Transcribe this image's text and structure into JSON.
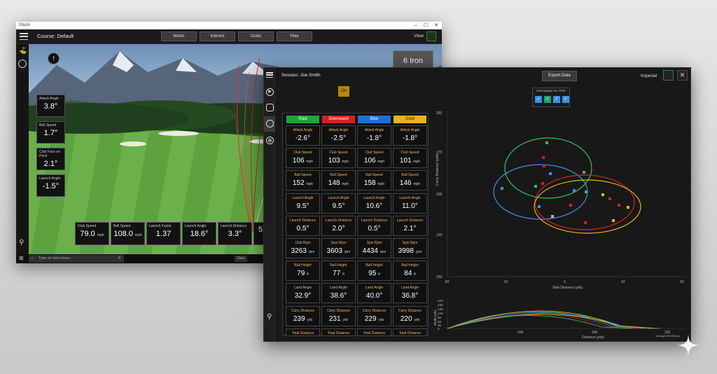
{
  "win1": {
    "title": "Gluon",
    "course_label": "Course: Default",
    "tabs": [
      "Metric",
      "Interest",
      "Clubs",
      "Hole"
    ],
    "view_label": "View",
    "club": "6 Iron",
    "left_stats": [
      {
        "label": "Attack Angle",
        "value": "3.8°"
      },
      {
        "label": "Ball Speed",
        "value": "1.7°"
      },
      {
        "label": "Club Face on Pnch",
        "value": "2.1°"
      },
      {
        "label": "Launch Angle",
        "value": "-1.5°"
      }
    ],
    "bottom_stats": [
      {
        "label": "Club Speed",
        "value": "79.0",
        "unit": "mph"
      },
      {
        "label": "Ball Speed",
        "value": "108.0",
        "unit": "mph"
      },
      {
        "label": "Launch Factor",
        "value": "1.37",
        "unit": ""
      },
      {
        "label": "Launch Angle",
        "value": "18.6°",
        "unit": ""
      },
      {
        "label": "Launch Distance",
        "value": "3.3°",
        "unit": ""
      },
      {
        "label": "",
        "value": "5",
        "unit": ""
      }
    ],
    "taskbar_search": "Type or microtone...",
    "taskbar_item": "Stats"
  },
  "win2": {
    "session": "Session: Joe Smith",
    "export_label": "Export Data",
    "imperial_label": "Imperial",
    "on_label": "On",
    "legend_title": "Dolnoapary loe ODR",
    "legend_colors": [
      "#3b8fe0",
      "#2ec46b",
      "#3b8fe0",
      "#3b8fe0"
    ],
    "columns": [
      {
        "name": "Raid",
        "bg": "#1fa33a",
        "color": "#ffffff"
      },
      {
        "name": "Downward",
        "bg": "#d42020",
        "color": "#ffffff"
      },
      {
        "name": "Blue",
        "bg": "#1f6fd6",
        "color": "#ffffff"
      },
      {
        "name": "Gold",
        "bg": "#e8b21c",
        "color": "#222222"
      }
    ],
    "rows": [
      {
        "label": [
          "Attack Angle",
          "Attack Angle",
          "Attack Angle",
          "Attack Angle"
        ],
        "values": [
          "-2.6°",
          "-2.5°",
          "-1.8°",
          "-1.8°"
        ],
        "units": [
          "",
          "",
          "",
          ""
        ]
      },
      {
        "label": [
          "Club Speed",
          "Club Speed",
          "Club Speed",
          "Club Speed"
        ],
        "values": [
          "106",
          "103",
          "106",
          "101"
        ],
        "units": [
          "mph",
          "mph",
          "mph",
          "mph"
        ]
      },
      {
        "label": [
          "Ball Speed",
          "Ball Speed",
          "Ball Speed",
          "Ball Speed"
        ],
        "values": [
          "152",
          "148",
          "158",
          "146"
        ],
        "units": [
          "mph",
          "mph",
          "mph",
          "mph"
        ]
      },
      {
        "label": [
          "Launch Angle",
          "Launch Angle",
          "Launch Angle",
          "Launch Angle"
        ],
        "values": [
          "9.5°",
          "9.5°",
          "10.6°",
          "11.0°"
        ],
        "units": [
          "",
          "",
          "",
          ""
        ]
      },
      {
        "label": [
          "Launch Distance",
          "Launch Distance",
          "Launch Distance",
          "Launch Distance"
        ],
        "values": [
          "0.5°",
          "2.0°",
          "0.5°",
          "2.1°"
        ],
        "units": [
          "",
          "",
          "",
          ""
        ]
      },
      {
        "label": [
          "Club Rpm",
          "Spin Rpm",
          "Spin Rpm",
          "Spin Rpm"
        ],
        "values": [
          "3263",
          "3603",
          "4434",
          "3998"
        ],
        "units": [
          "rpm",
          "rpm",
          "rpm",
          "rpm"
        ]
      },
      {
        "label": [
          "Ball Height",
          "Ball Height",
          "Ball Height",
          "Ball Height"
        ],
        "values": [
          "79",
          "77",
          "95",
          "84"
        ],
        "units": [
          "ft",
          "ft",
          "ft",
          "ft"
        ]
      },
      {
        "label": [
          "Land Angle",
          "Land Angle",
          "Land Angle",
          "Land Angle"
        ],
        "values": [
          "32.9°",
          "38.6°",
          "40.0°",
          "36.8°"
        ],
        "units": [
          "",
          "",
          "",
          ""
        ]
      },
      {
        "label": [
          "Carry Distance",
          "Carry Distance",
          "Carry Distance",
          "Carry Distance"
        ],
        "values": [
          "239",
          "231",
          "229",
          "220"
        ],
        "units": [
          "yds",
          "yds",
          "yds",
          "yds"
        ]
      },
      {
        "label": [
          "Total Distance",
          "Total Distance",
          "Total Distance",
          "Total Distance"
        ],
        "values": [
          "",
          "",
          "",
          ""
        ],
        "units": [
          "",
          "",
          "",
          ""
        ]
      }
    ],
    "scatter_y_label": "Carry Distance (yds)",
    "scatter_x_label": "Side Distance (yds)",
    "scatter_y_ticks": [
      "260",
      "170",
      "200",
      "130",
      "230"
    ],
    "scatter_x_ticks": [
      "-20",
      "-10",
      "0",
      "10",
      "20"
    ],
    "traj_y_label": "Width (yds)",
    "traj_x_label": "Distance (yds)",
    "traj_y_ticks": [
      "270",
      "240",
      "130",
      "120",
      "90",
      "60",
      "30",
      "0"
    ],
    "traj_x_ticks": [
      "100",
      "200",
      "220"
    ],
    "traj_note": "Average 000.000 yds"
  }
}
